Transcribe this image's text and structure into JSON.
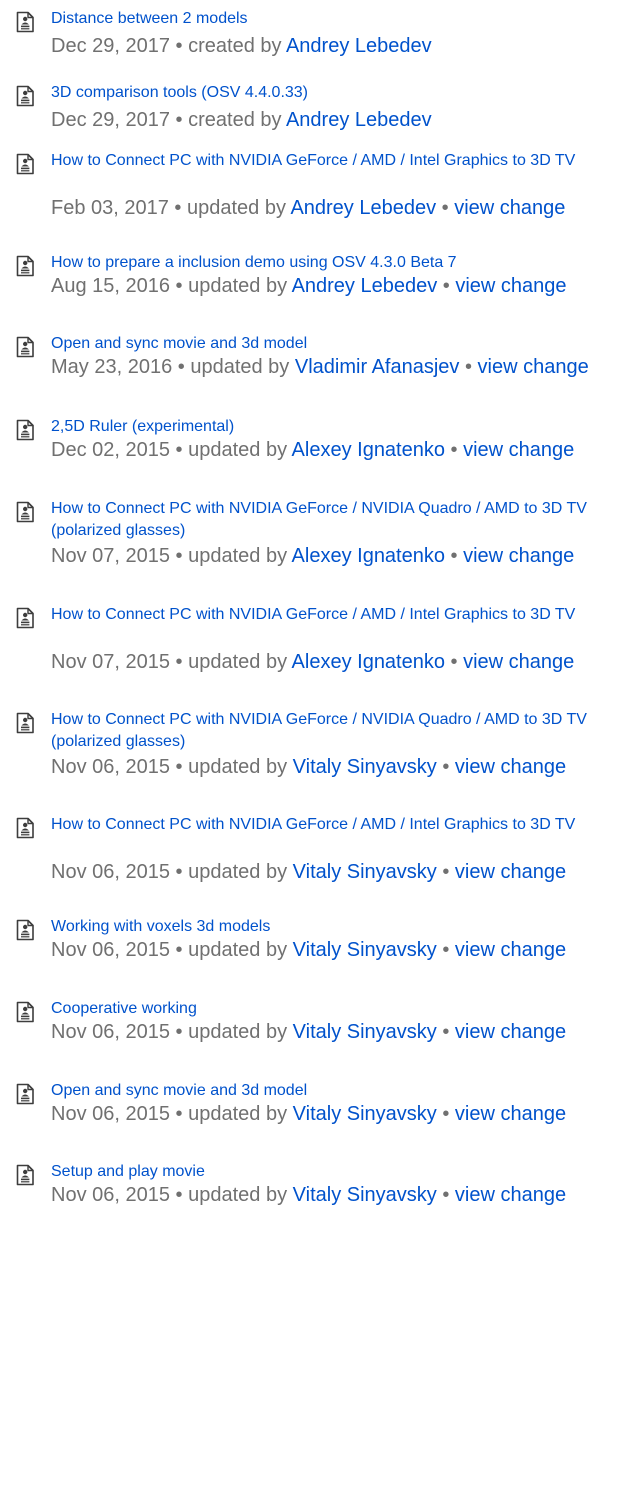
{
  "icon_name": "page-icon",
  "link_color": "#0052cc",
  "meta_color": "#707070",
  "entries": [
    {
      "title": "Distance between 2 models",
      "date": "Dec 29, 2017",
      "action": "created by",
      "author": "Andrey Lebedev",
      "view_change": null
    },
    {
      "title": "3D comparison tools (OSV 4.4.0.33)",
      "date": "Dec 29, 2017",
      "action": "created by",
      "author": "Andrey Lebedev",
      "view_change": null
    },
    {
      "title": "How to Connect PC with NVIDIA GeForce / AMD / Intel Graphics to 3D TV",
      "date": "Feb 03, 2017",
      "action": "updated by",
      "author": "Andrey Lebedev",
      "view_change": "view change"
    },
    {
      "title": "How to prepare a inclusion demo using OSV 4.3.0 Beta 7",
      "date": "Aug 15, 2016",
      "action": "updated by",
      "author": "Andrey Lebedev",
      "view_change": "view change"
    },
    {
      "title": "Open and sync movie and 3d model",
      "date": "May 23, 2016",
      "action": "updated by",
      "author": "Vladimir Afanasjev",
      "view_change": "view change"
    },
    {
      "title": "2,5D Ruler (experimental)",
      "date": "Dec 02, 2015",
      "action": "updated by",
      "author": "Alexey Ignatenko",
      "view_change": "view change"
    },
    {
      "title": "How to Connect PC with NVIDIA GeForce / NVIDIA Quadro / AMD to 3D TV (polarized glasses)",
      "date": "Nov 07, 2015",
      "action": "updated by",
      "author": "Alexey Ignatenko",
      "view_change": "view change"
    },
    {
      "title": "How to Connect PC with NVIDIA GeForce / AMD / Intel Graphics to 3D TV",
      "date": "Nov 07, 2015",
      "action": "updated by",
      "author": "Alexey Ignatenko",
      "view_change": "view change"
    },
    {
      "title": "How to Connect PC with NVIDIA GeForce / NVIDIA Quadro / AMD to 3D TV (polarized glasses)",
      "date": "Nov 06, 2015",
      "action": "updated by",
      "author": "Vitaly Sinyavsky",
      "view_change": "view change"
    },
    {
      "title": "How to Connect PC with NVIDIA GeForce / AMD / Intel Graphics to 3D TV",
      "date": "Nov 06, 2015",
      "action": "updated by",
      "author": "Vitaly Sinyavsky",
      "view_change": "view change"
    },
    {
      "title": "Working with voxels 3d models",
      "date": "Nov 06, 2015",
      "action": "updated by",
      "author": "Vitaly Sinyavsky",
      "view_change": "view change"
    },
    {
      "title": "Cooperative working",
      "date": "Nov 06, 2015",
      "action": "updated by",
      "author": "Vitaly Sinyavsky",
      "view_change": "view change"
    },
    {
      "title": "Open and sync movie and 3d model",
      "date": "Nov 06, 2015",
      "action": "updated by",
      "author": "Vitaly Sinyavsky",
      "view_change": "view change"
    },
    {
      "title": "Setup and play movie",
      "date": "Nov 06, 2015",
      "action": "updated by",
      "author": "Vitaly Sinyavsky",
      "view_change": "view change"
    }
  ]
}
